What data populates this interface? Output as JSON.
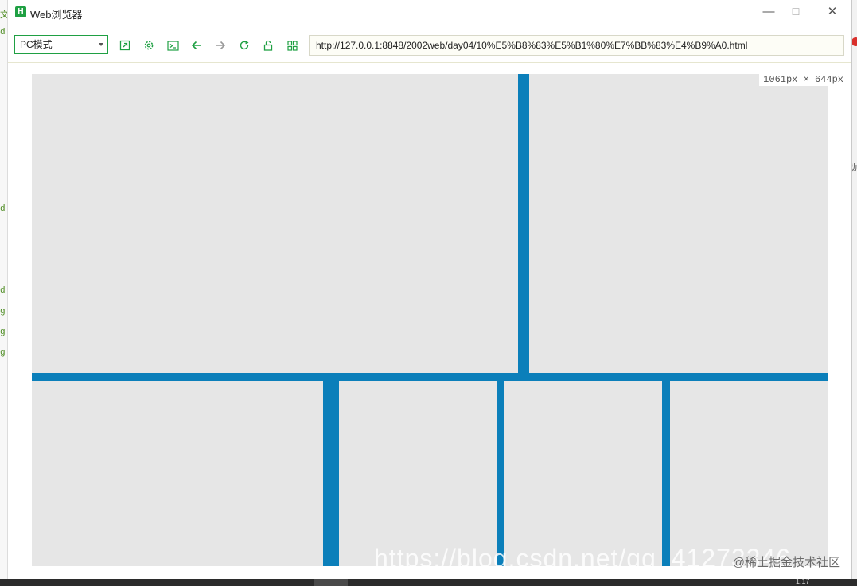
{
  "window": {
    "app_icon_letter": "H",
    "title": "Web浏览器",
    "controls": {
      "minimize": "—",
      "maximize": "☐",
      "close": "✕"
    }
  },
  "toolbar": {
    "mode": "PC模式",
    "url": "http://127.0.0.1:8848/2002web/day04/10%E5%B8%83%E5%B1%80%E7%BB%83%E4%B9%A0.html"
  },
  "page": {
    "size_label": "1061px × 644px"
  },
  "watermark": {
    "url_text": "https://blog.csdn.net/qq_41273346",
    "tag": "@稀土掘金技术社区"
  },
  "background": {
    "left_fragments": [
      "文",
      "d",
      "d",
      "d",
      "g",
      "g",
      "g"
    ],
    "right_fragments": [
      "动"
    ],
    "taskbar_text": "1:17"
  },
  "colors": {
    "accent_green": "#1fa043",
    "layout_blue": "#0b7fba",
    "cell_gray": "#e6e6e6"
  }
}
